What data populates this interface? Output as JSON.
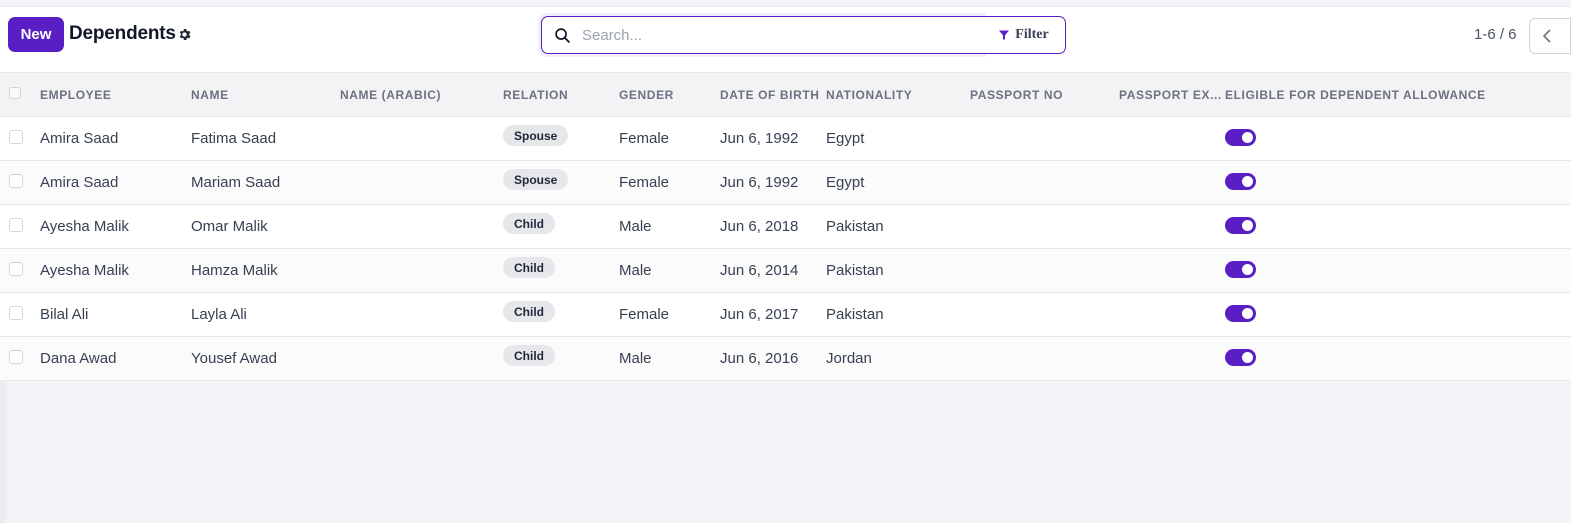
{
  "header": {
    "new_label": "New",
    "title": "Dependents",
    "search_placeholder": "Search...",
    "filter_label": "Filter",
    "pagination": "1-6 / 6"
  },
  "table": {
    "columns": [
      "EMPLOYEE",
      "NAME",
      "NAME (ARABIC)",
      "RELATION",
      "GENDER",
      "DATE OF BIRTH",
      "NATIONALITY",
      "PASSPORT NO",
      "PASSPORT EX...",
      "ELIGIBLE FOR DEPENDENT ALLOWANCE"
    ],
    "rows": [
      {
        "employee": "Amira Saad",
        "name": "Fatima Saad",
        "name_arabic": "",
        "relation": "Spouse",
        "gender": "Female",
        "dob": "Jun 6, 1992",
        "nationality": "Egypt",
        "passport_no": "",
        "passport_exp": "",
        "eligible": true
      },
      {
        "employee": "Amira Saad",
        "name": "Mariam Saad",
        "name_arabic": "",
        "relation": "Spouse",
        "gender": "Female",
        "dob": "Jun 6, 1992",
        "nationality": "Egypt",
        "passport_no": "",
        "passport_exp": "",
        "eligible": true
      },
      {
        "employee": "Ayesha Malik",
        "name": "Omar Malik",
        "name_arabic": "",
        "relation": "Child",
        "gender": "Male",
        "dob": "Jun 6, 2018",
        "nationality": "Pakistan",
        "passport_no": "",
        "passport_exp": "",
        "eligible": true
      },
      {
        "employee": "Ayesha Malik",
        "name": "Hamza Malik",
        "name_arabic": "",
        "relation": "Child",
        "gender": "Male",
        "dob": "Jun 6, 2014",
        "nationality": "Pakistan",
        "passport_no": "",
        "passport_exp": "",
        "eligible": true
      },
      {
        "employee": "Bilal Ali",
        "name": "Layla Ali",
        "name_arabic": "",
        "relation": "Child",
        "gender": "Female",
        "dob": "Jun 6, 2017",
        "nationality": "Pakistan",
        "passport_no": "",
        "passport_exp": "",
        "eligible": true
      },
      {
        "employee": "Dana Awad",
        "name": "Yousef Awad",
        "name_arabic": "",
        "relation": "Child",
        "gender": "Male",
        "dob": "Jun 6, 2016",
        "nationality": "Jordan",
        "passport_no": "",
        "passport_exp": "",
        "eligible": true
      }
    ]
  },
  "colors": {
    "accent": "#5a1fc4",
    "badge_bg": "#e5e7eb",
    "header_bg": "#f3f3f6"
  },
  "icons": {
    "settings": "gear-icon",
    "search": "search-icon",
    "filter": "filter-icon",
    "prev": "chevron-left-icon"
  }
}
